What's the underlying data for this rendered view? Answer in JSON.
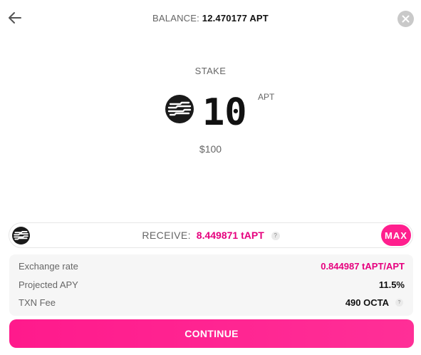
{
  "header": {
    "balance_label": "BALANCE:",
    "balance_value": "12.470177 APT",
    "back_icon": "arrow-left-icon",
    "close_icon": "close-icon"
  },
  "stake": {
    "title": "STAKE",
    "amount": "10",
    "unit": "APT",
    "usd_value": "$100",
    "token_icon": "aptos-logo-icon"
  },
  "receive": {
    "label": "RECEIVE:",
    "value": "8.449871 tAPT",
    "help": "?",
    "max_label": "MAX"
  },
  "details": {
    "exchange_rate_label": "Exchange rate",
    "exchange_rate_value": "0.844987 tAPT/APT",
    "apy_label": "Projected APY",
    "apy_value": "11.5%",
    "fee_label": "TXN Fee",
    "fee_value": "490 OCTA",
    "fee_help": "?"
  },
  "actions": {
    "continue_label": "CONTINUE"
  },
  "colors": {
    "accent": "#ff1f8e",
    "accent_text": "#e6007e"
  }
}
